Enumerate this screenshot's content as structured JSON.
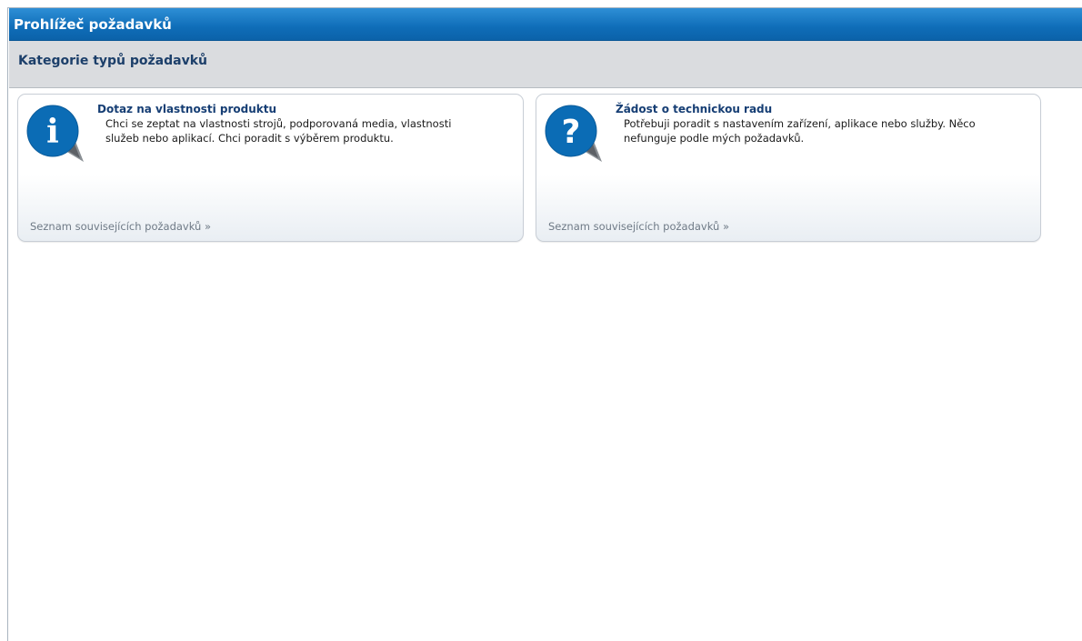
{
  "window": {
    "title": "Prohlížeč požadavků"
  },
  "section": {
    "title": "Kategorie typů požadavků"
  },
  "cards": [
    {
      "title": "Dotaz na vlastnosti produktu",
      "description": "Chci se zeptat na vlastnosti strojů, podporovaná media, vlastnosti služeb nebo aplikací. Chci poradit s výběrem produktu.",
      "link": "Seznam souvisejících požadavků »",
      "icon": "info-icon",
      "icon_glyph": "i"
    },
    {
      "title": "Žádost o technickou radu",
      "description": "Potřebuji poradit s nastavením zařízení, aplikace nebo služby. Něco nefunguje podle mých požadavků.",
      "link": "Seznam souvisejících požadavků »",
      "icon": "question-icon",
      "icon_glyph": "?"
    }
  ],
  "colors": {
    "titlebar": "#0f6db8",
    "subheader": "#dadcdf",
    "card_title": "#163e74",
    "icon_blue": "#0b6cb5"
  }
}
